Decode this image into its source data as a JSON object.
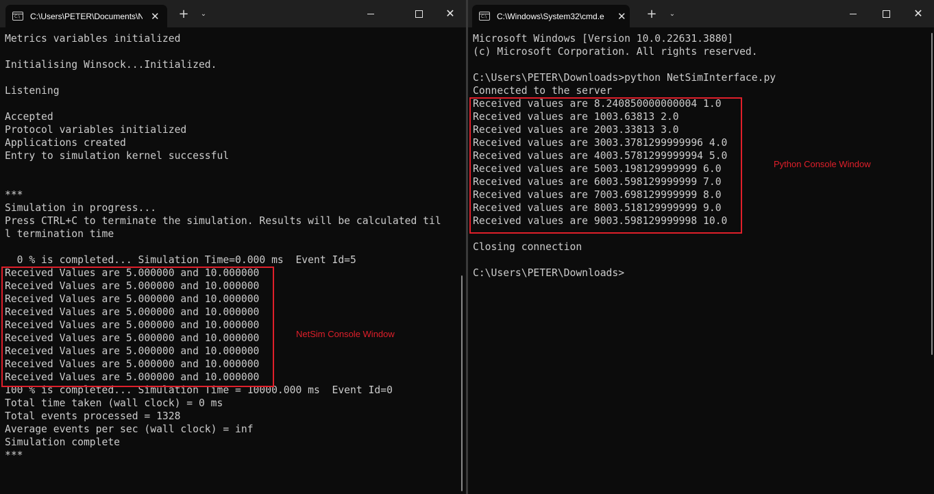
{
  "left_window": {
    "tab_title": "C:\\Users\\PETER\\Documents\\N",
    "icon_text": "C:\\",
    "lines": [
      "Metrics variables initialized",
      "",
      "Initialising Winsock...Initialized.",
      "",
      "Listening",
      "",
      "Accepted",
      "Protocol variables initialized",
      "Applications created",
      "Entry to simulation kernel successful",
      "",
      "",
      "***",
      "Simulation in progress...",
      "Press CTRL+C to terminate the simulation. Results will be calculated til",
      "l termination time",
      "",
      "  0 % is completed... Simulation Time=0.000 ms  Event Id=5",
      "Received Values are 5.000000 and 10.000000",
      "Received Values are 5.000000 and 10.000000",
      "Received Values are 5.000000 and 10.000000",
      "Received Values are 5.000000 and 10.000000",
      "Received Values are 5.000000 and 10.000000",
      "Received Values are 5.000000 and 10.000000",
      "Received Values are 5.000000 and 10.000000",
      "Received Values are 5.000000 and 10.000000",
      "Received Values are 5.000000 and 10.000000",
      "100 % is completed... Simulation Time = 10000.000 ms  Event Id=0",
      "Total time taken (wall clock) = 0 ms",
      "Total events processed = 1328",
      "Average events per sec (wall clock) = inf",
      "Simulation complete",
      "***"
    ],
    "annotation": "NetSim Console Window"
  },
  "right_window": {
    "tab_title": "C:\\Windows\\System32\\cmd.e",
    "icon_text": "C:\\",
    "lines": [
      "Microsoft Windows [Version 10.0.22631.3880]",
      "(c) Microsoft Corporation. All rights reserved.",
      "",
      "C:\\Users\\PETER\\Downloads>python NetSimInterface.py",
      "Connected to the server",
      "Received values are 8.240850000000004 1.0",
      "Received values are 1003.63813 2.0",
      "Received values are 2003.33813 3.0",
      "Received values are 3003.3781299999996 4.0",
      "Received values are 4003.5781299999994 5.0",
      "Received values are 5003.198129999999 6.0",
      "Received values are 6003.598129999999 7.0",
      "Received values are 7003.698129999999 8.0",
      "Received values are 8003.518129999999 9.0",
      "Received values are 9003.598129999998 10.0",
      "",
      "Closing connection",
      "",
      "C:\\Users\\PETER\\Downloads>"
    ],
    "annotation": "Python Console Window"
  },
  "controls": {
    "new_tab": "+",
    "dropdown": "⌄",
    "tab_close": "✕",
    "window_close": "✕"
  },
  "colors": {
    "console_bg": "#0c0c0c",
    "console_text": "#cccccc",
    "titlebar": "#202020",
    "highlight": "#e01f2a"
  }
}
